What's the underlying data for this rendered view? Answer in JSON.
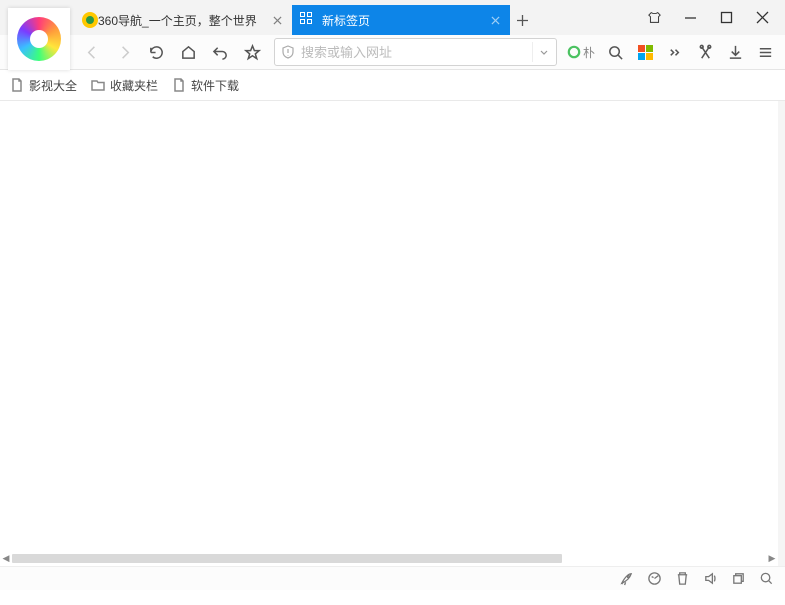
{
  "tabs": [
    {
      "label": "360导航_一个主页，整个世界",
      "active": false
    },
    {
      "label": "新标签页",
      "active": true
    }
  ],
  "address": {
    "placeholder": "搜索或输入网址",
    "value": ""
  },
  "search_brand": "朴",
  "bookmarks": [
    {
      "label": "影视大全",
      "type": "page"
    },
    {
      "label": "收藏夹栏",
      "type": "folder"
    },
    {
      "label": "软件下载",
      "type": "page"
    }
  ],
  "icons": {
    "tshirt": "tshirt-icon",
    "minimize": "minimize-icon",
    "maximize": "maximize-icon",
    "close": "close-icon"
  }
}
